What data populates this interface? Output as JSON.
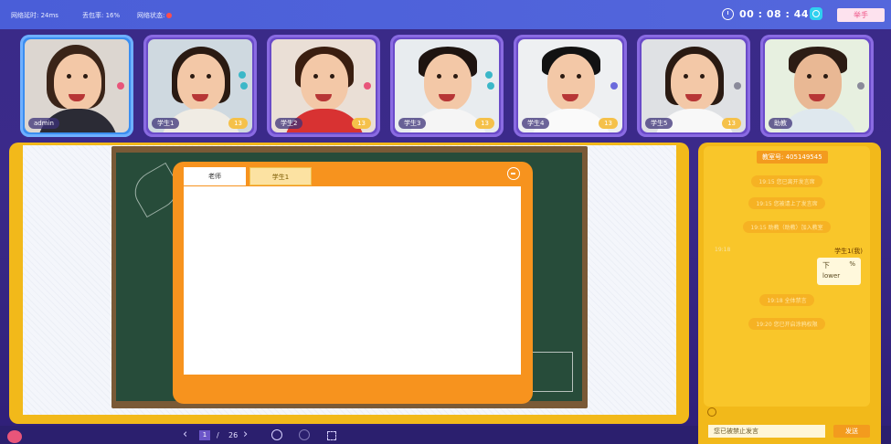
{
  "topbar": {
    "latency_label": "网络延时: 24ms",
    "loss_label": "丢包率: 16%",
    "status_label": "网络状态:",
    "timer": "00 : 08 : 44",
    "hand_button": "举手"
  },
  "students": [
    {
      "name": "admin",
      "active": true,
      "star": ""
    },
    {
      "name": "学生1",
      "star": "13"
    },
    {
      "name": "学生2",
      "star": "13"
    },
    {
      "name": "学生3",
      "star": "13"
    },
    {
      "name": "学生4",
      "star": "13"
    },
    {
      "name": "学生5",
      "star": "13"
    },
    {
      "name": "助教",
      "star": ""
    }
  ],
  "panel": {
    "tabs": [
      "老师",
      "学生1"
    ]
  },
  "pager": {
    "current": "1",
    "separator": "/",
    "total": "26"
  },
  "chat": {
    "room_label": "教室号: 405149545",
    "system_msgs": [
      "19:15  您已离开发言席",
      "19:15  您被请上了发言席",
      "19:15  助教（助教）加入教室",
      "19:18  全体禁言",
      "19:20  您已开启涂鸦权限"
    ],
    "msg_time": "19:18",
    "msg_user": "学生1(我)",
    "bubble_line1": "下",
    "bubble_pct": "%",
    "bubble_line2": "lower",
    "input_value": "您已被禁止发言",
    "send_button": "发送"
  },
  "colors": {
    "accent": "#5467dc",
    "panel": "#f7931e",
    "chat_bg": "#f2b91a"
  }
}
